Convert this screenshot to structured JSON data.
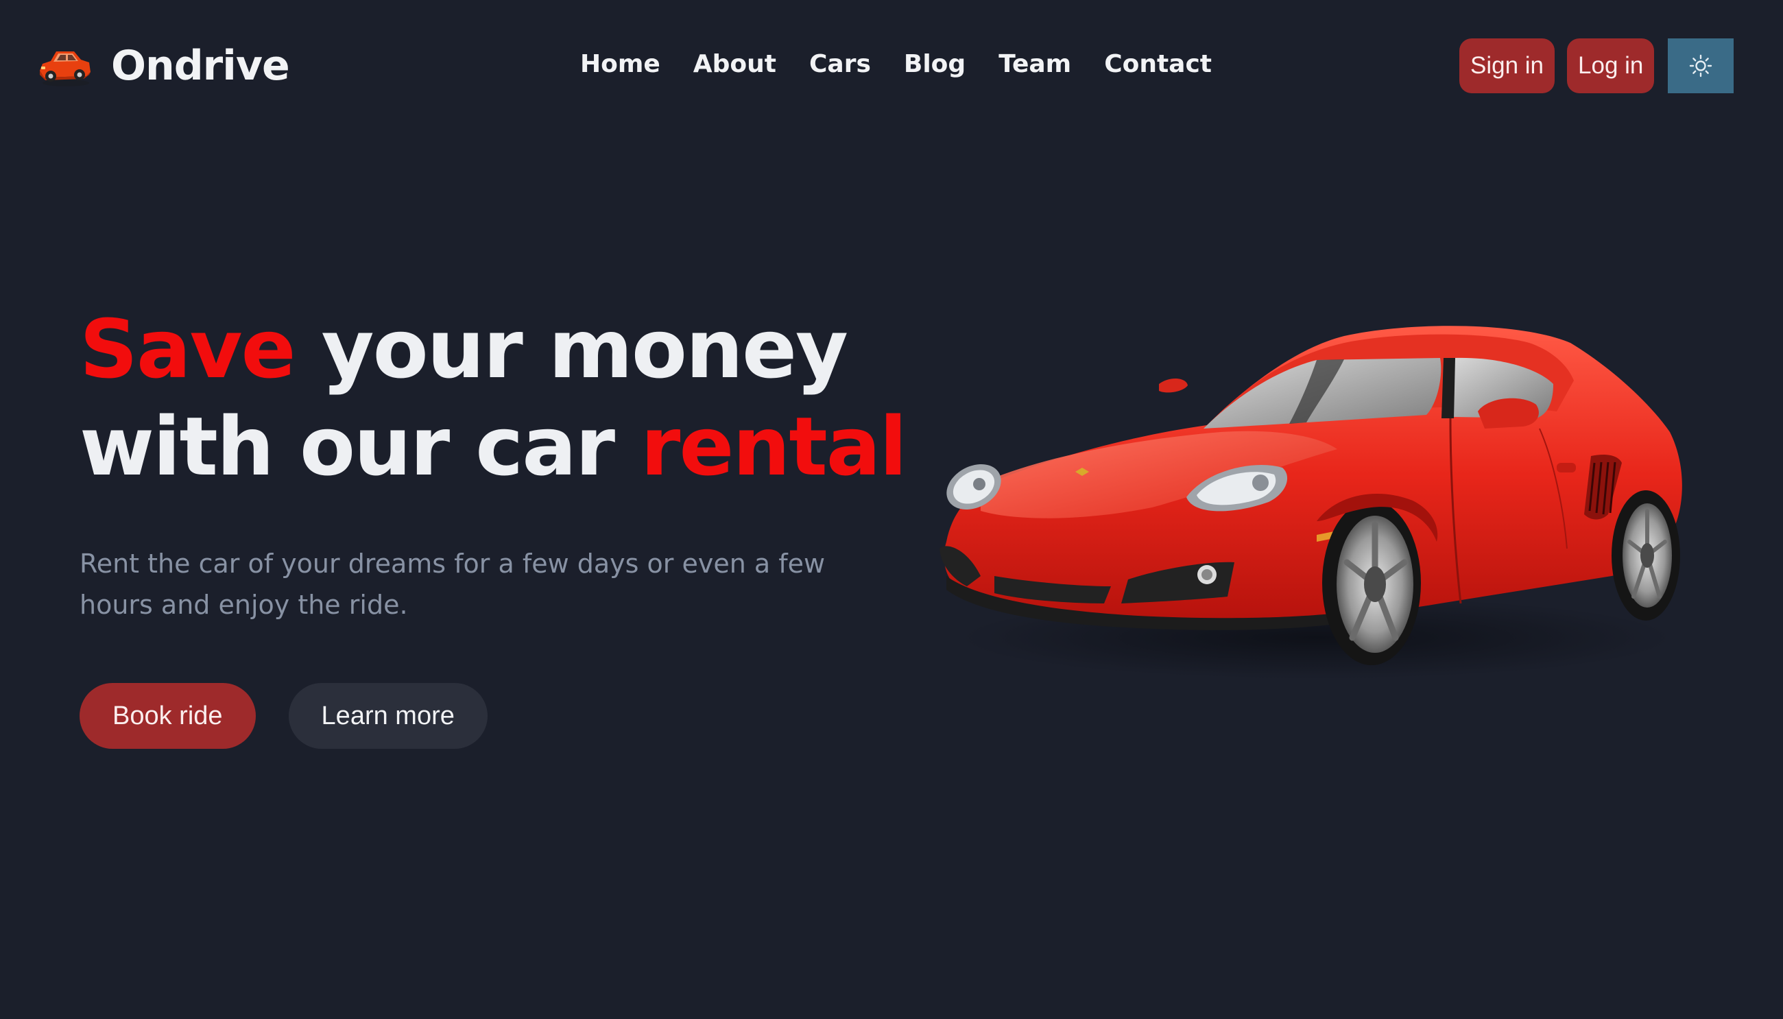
{
  "brand": {
    "name": "Ondrive",
    "logo_icon": "car-icon"
  },
  "nav": {
    "items": [
      {
        "label": "Home"
      },
      {
        "label": "About"
      },
      {
        "label": "Cars"
      },
      {
        "label": "Blog"
      },
      {
        "label": "Team"
      },
      {
        "label": "Contact"
      }
    ]
  },
  "auth": {
    "sign_in_label": "Sign in",
    "log_in_label": "Log in"
  },
  "theme_toggle": {
    "icon": "sun-icon"
  },
  "hero": {
    "title_word_1": "Save",
    "title_part_2": " your money",
    "title_part_3": "with our car ",
    "title_word_4": "rental",
    "subtitle": "Rent the car of your dreams for a few days or even a few hours and enjoy the ride.",
    "primary_cta": "Book ride",
    "secondary_cta": "Learn more",
    "image": "red-sports-car"
  },
  "colors": {
    "background": "#1b1f2b",
    "accent_red": "#f20d0d",
    "button_red": "#9e2a2b",
    "theme_button": "#3a6b87",
    "secondary_button": "#2b2f3b",
    "muted_text": "#8892a4"
  }
}
